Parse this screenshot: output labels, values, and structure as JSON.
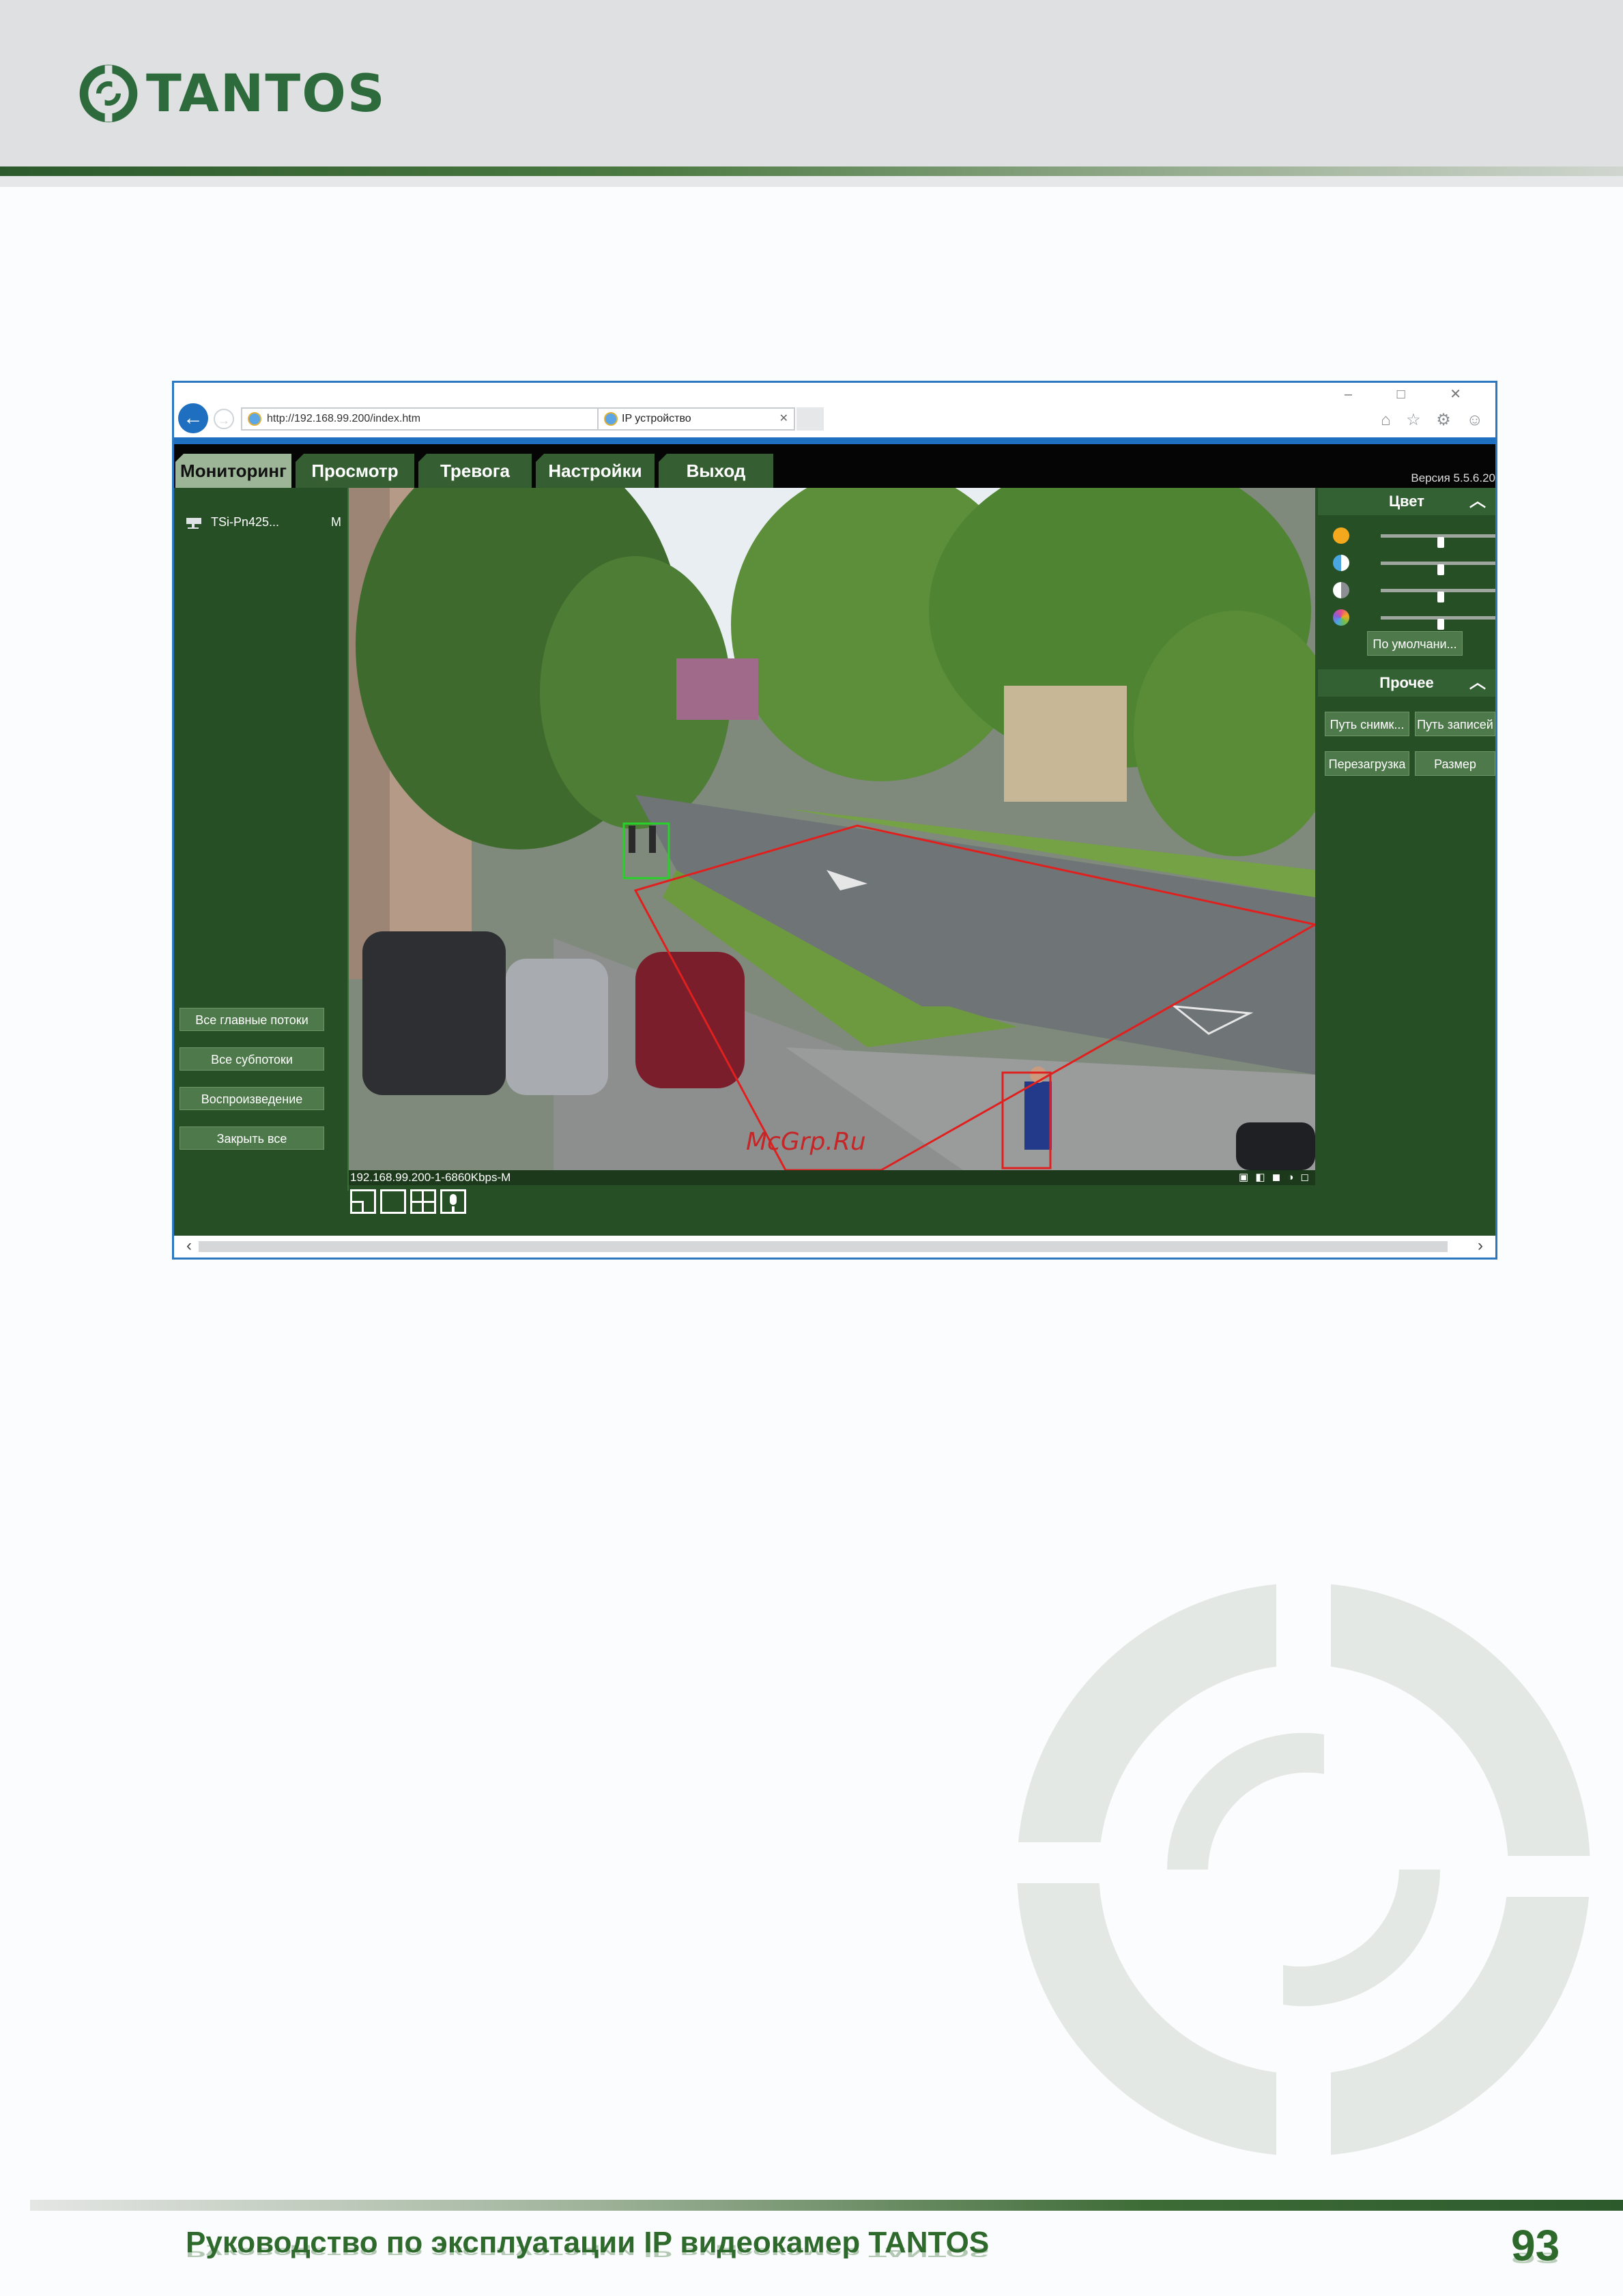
{
  "header": {
    "brand": "TANTOS",
    "accent_color": "#2e6b3c"
  },
  "browser": {
    "url": "http://192.168.99.200/index.htm",
    "tab_title": "IP устройство",
    "window_controls": "–  □  ✕",
    "toolbar_icons": "⌂ ☆ ⚙ ☺"
  },
  "app": {
    "menu": [
      "Мониторинг",
      "Просмотр",
      "Тревога",
      "Настройки",
      "Выход"
    ],
    "active_menu": "Мониторинг",
    "version": "Версия 5.5.6.20",
    "camera": {
      "name": "TSi-Pn425...",
      "stream": "M"
    },
    "left_buttons": [
      "Все главные потоки",
      "Все субпотоки",
      "Воспроизведение",
      "Закрыть все"
    ],
    "video": {
      "status": "192.168.99.200-1-6860Kbps-M",
      "watermark": "McGrp.Ru"
    },
    "color_panel": {
      "title": "Цвет",
      "sliders": [
        {
          "name": "brightness",
          "icon_color": "#f3a81d",
          "level": 0.5
        },
        {
          "name": "contrast",
          "icon_color": "#4aa6e0",
          "level": 0.5
        },
        {
          "name": "saturation",
          "icon_color": "#bfc3c6",
          "level": 0.5
        },
        {
          "name": "hue",
          "icon_color": "#e84b8a",
          "level": 0.5
        }
      ],
      "default_button": "По умолчани..."
    },
    "other_panel": {
      "title": "Прочее",
      "buttons": [
        "Путь снимк...",
        "Путь записей",
        "Перезагрузка",
        "Размер"
      ]
    }
  },
  "footer": {
    "title": "Руководство по эксплуатации IP видеокамер TANTOS",
    "page_number": "93"
  }
}
